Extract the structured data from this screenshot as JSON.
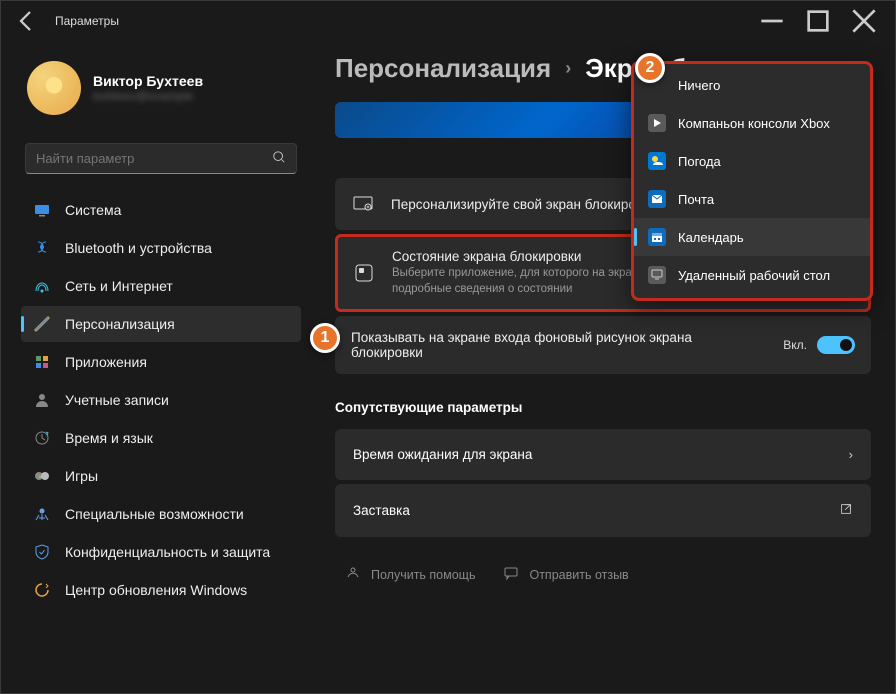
{
  "app_title": "Параметры",
  "user": {
    "name": "Виктор Бухтеев",
    "email": "buhteev@example"
  },
  "search": {
    "placeholder": "Найти параметр"
  },
  "sidebar": {
    "items": [
      {
        "label": "Система"
      },
      {
        "label": "Bluetooth и устройства"
      },
      {
        "label": "Сеть и Интернет"
      },
      {
        "label": "Персонализация"
      },
      {
        "label": "Приложения"
      },
      {
        "label": "Учетные записи"
      },
      {
        "label": "Время и язык"
      },
      {
        "label": "Игры"
      },
      {
        "label": "Специальные возможности"
      },
      {
        "label": "Конфиденциальность и защита"
      },
      {
        "label": "Центр обновления Windows"
      }
    ],
    "active_index": 3
  },
  "breadcrumb": {
    "parent": "Персонализация",
    "current": "Экран блокировки"
  },
  "cards": {
    "personalize": {
      "title": "Персонализируйте свой экран блокировки"
    },
    "status": {
      "title": "Состояние экрана блокировки",
      "desc": "Выберите приложение, для которого на экране блокировки будут выводиться подробные сведения о состоянии"
    },
    "background": {
      "title": "Показывать на экране входа фоновый рисунок экрана блокировки",
      "toggle_label": "Вкл."
    }
  },
  "related": {
    "header": "Сопутствующие параметры",
    "items": [
      {
        "label": "Время ожидания для экрана"
      },
      {
        "label": "Заставка"
      }
    ]
  },
  "helpers": {
    "help": "Получить помощь",
    "feedback": "Отправить отзыв"
  },
  "dropdown": {
    "items": [
      {
        "label": "Ничего",
        "color": ""
      },
      {
        "label": "Компаньон консоли Xbox",
        "color": "#5a5a5a"
      },
      {
        "label": "Погода",
        "color": "#0078d4"
      },
      {
        "label": "Почта",
        "color": "#0f6cbd"
      },
      {
        "label": "Календарь",
        "color": "#0f6cbd"
      },
      {
        "label": "Удаленный рабочий стол",
        "color": "#5a5a5a"
      }
    ],
    "selected_index": 4
  },
  "markers": {
    "1": "1",
    "2": "2"
  }
}
